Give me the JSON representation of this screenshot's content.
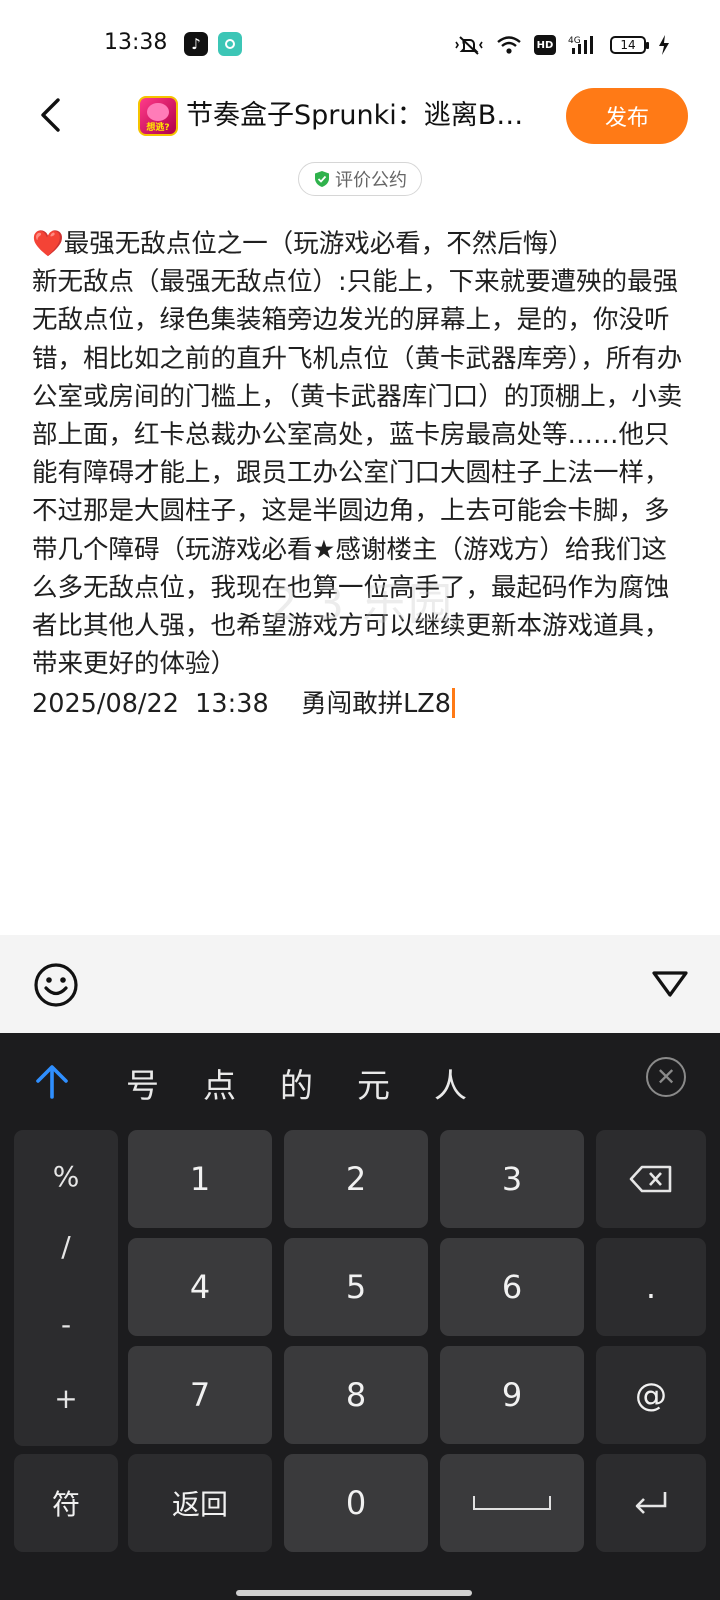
{
  "status_bar": {
    "time": "13:38",
    "battery_level": "14",
    "hd_label": "HD",
    "network_label": "4G",
    "icons": [
      "tiktok-icon",
      "app-icon",
      "mute-vibrate-icon",
      "wifi-icon",
      "hd-icon",
      "signal-icon",
      "battery-icon",
      "charging-icon"
    ]
  },
  "header": {
    "back_icon": "chevron-left-icon",
    "game_icon_text": "想逃?",
    "title": "节奏盒子Sprunki：逃离B…",
    "publish_label": "发布"
  },
  "rules": {
    "label": "评价公约",
    "icon": "shield-check-icon"
  },
  "review": {
    "heart": "❤️",
    "text": "最强无敌点位之一（玩游戏必看，不然后悔）\n新无敌点（最强无敌点位）:只能上，下来就要遭殃的最强无敌点位，绿色集装箱旁边发光的屏幕上，是的，你没听错，相比如之前的直升飞机点位（黄卡武器库旁），所有办公室或房间的门槛上，（黄卡武器库门口）的顶棚上，小卖部上面，红卡总裁办公室高处，蓝卡房最高处等……他只能有障碍才能上，跟员工办公室门口大圆柱子上法一样，不过那是大圆柱子，这是半圆边角，上去可能会卡脚，多带几个障碍（玩游戏必看★感谢楼主（游戏方）给我们这么多无敌点位，我现在也算一位高手了，最起码作为腐蚀者比其他人强，也希望游戏方可以继续更新本游戏道具，带来更好的体验）",
    "signature": "2025/08/22  13:38    勇闯敢拼LZ8"
  },
  "watermark": "2 3 乐园",
  "composer": {
    "emoji_icon": "emoji-smile-icon",
    "collapse_icon": "triangle-down-icon"
  },
  "keyboard": {
    "suggestions": [
      "号",
      "点",
      "的",
      "元",
      "人"
    ],
    "symbols": [
      "%",
      "/",
      "-",
      "+"
    ],
    "digits": [
      "1",
      "2",
      "3",
      "4",
      "5",
      "6",
      "7",
      "8",
      "9",
      "0"
    ],
    "dot": ".",
    "at": "@",
    "fu_label": "符",
    "back_label": "返回",
    "accent_color": "#2f8fff"
  },
  "colors": {
    "publish": "#ff7a16",
    "keyboard_bg": "#1c1c1e",
    "key_bg": "#3a3a3c"
  }
}
